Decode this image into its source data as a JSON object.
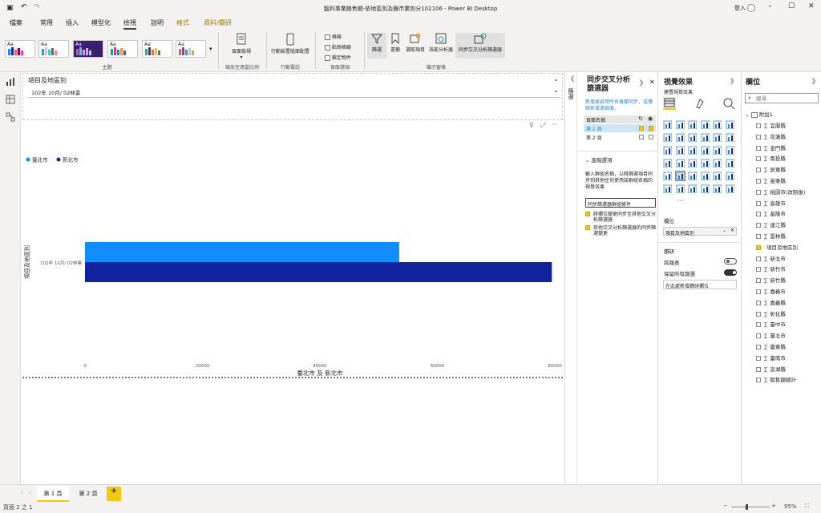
{
  "window": {
    "title": "盤利事業銷售額-依地區別及縣市業別分102106 - Power BI Desktop",
    "user": "登入"
  },
  "menu_tabs": [
    "檔案",
    "常用",
    "插入",
    "模型化",
    "檢視",
    "說明",
    "格式",
    "資料/鑽研"
  ],
  "ribbon": {
    "group_theme": "主題",
    "page_view": "頁面檢視",
    "group_scale": "縮放至適當比例",
    "mobile_layout": "行動裝置版面配置",
    "group_mobile": "行動電話",
    "checkboxes": [
      "格線",
      "貼齊格線",
      "鎖定物件"
    ],
    "group_page": "頁面選項",
    "panes": [
      "篩選",
      "書籤",
      "選取項目",
      "效能分析器",
      "同步交叉分析篩選器"
    ],
    "group_show": "顯示窗格"
  },
  "slicer": {
    "title": "項目及地區別",
    "value": "102年 10月/ 02林業"
  },
  "chart_data": {
    "type": "bar",
    "orientation": "horizontal",
    "legend": [
      "臺北市",
      "新北市"
    ],
    "legend_position": "top-left",
    "categories": [
      "102年 10月/ 02林業"
    ],
    "series": [
      {
        "name": "臺北市",
        "values": [
          53500
        ],
        "color": "#118dff"
      },
      {
        "name": "新北市",
        "values": [
          79500
        ],
        "color": "#12239e"
      }
    ],
    "xlim": [
      0,
      80000
    ],
    "xticks": [
      "0",
      "20000",
      "40000",
      "60000",
      "80000"
    ],
    "xlabel": "臺北市 及 新北市",
    "ylabel": "項目及地區別"
  },
  "pages": [
    "第 1 頁",
    "第 2 頁"
  ],
  "add_page": "+",
  "status": {
    "page_info": "頁面 2 之 1",
    "zoom": "95%"
  },
  "sync_pane": {
    "title": "同步交叉分析篩選器",
    "vertical_label": "篩選",
    "hint": "新增並啟用所有頁面同步，或僅將新增選頁面。",
    "col_header": "頁面名稱",
    "rows": [
      "第 1 頁",
      "第 2 頁"
    ],
    "advanced": "進階選項",
    "advanced_desc": "輸入群組名稱，以將篩選項目同步到其他任何使用該群組名稱的視覺效果",
    "group_name": "同步篩選器群組條件",
    "opt1": "將欄位變更同步至其他交叉分析篩選器",
    "opt2": "其他交叉分析篩選器的同步篩選變更"
  },
  "viz_pane": {
    "title": "視覺效果",
    "subtitle": "建置視覺效果",
    "field_label": "欄位",
    "field_value": "項目及地區別",
    "section": "鑽研",
    "toggle1": "跨報表",
    "toggle2": "保留所有篩選",
    "drill_add": "在此處新增鑽研欄位",
    "more": "···"
  },
  "field_pane": {
    "title": "欄位",
    "search_placeholder": "搜尋",
    "table": "附加1",
    "fields": [
      "宜蘭縣",
      "花蓮縣",
      "金門縣",
      "南投縣",
      "屏東縣",
      "苗栗縣",
      "桃園市(改制後)",
      "高雄市",
      "基隆市",
      "連江縣",
      "雲林縣",
      "項目及地區別",
      "新北市",
      "新竹市",
      "新竹縣",
      "嘉義市",
      "嘉義縣",
      "彰化縣",
      "臺中市",
      "臺北市",
      "臺東縣",
      "臺南市",
      "澎湖縣",
      "銷售額總計"
    ],
    "checked": "項目及地區別"
  }
}
